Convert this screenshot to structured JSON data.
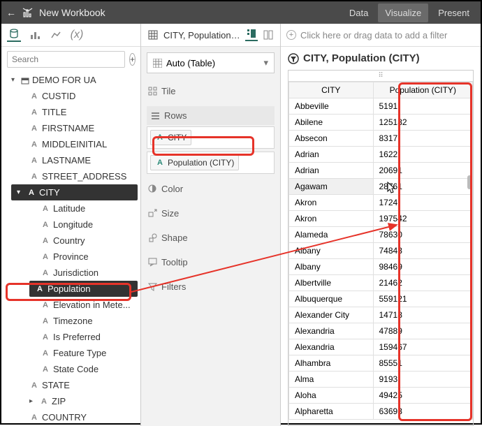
{
  "topbar": {
    "title": "New Workbook",
    "tabs": {
      "data": "Data",
      "visualize": "Visualize",
      "present": "Present"
    }
  },
  "sidebar": {
    "search_placeholder": "Search",
    "root": "DEMO FOR UA",
    "fields": {
      "custid": "CUSTID",
      "title": "TITLE",
      "firstname": "FIRSTNAME",
      "middleinitial": "MIDDLEINITIAL",
      "lastname": "LASTNAME",
      "street_address": "STREET_ADDRESS",
      "city": "CITY",
      "latitude": "Latitude",
      "longitude": "Longitude",
      "country": "Country",
      "province": "Province",
      "jurisdiction": "Jurisdiction",
      "population": "Population",
      "elevation": "Elevation in Mete...",
      "timezone": "Timezone",
      "is_preferred": "Is Preferred",
      "feature_type": "Feature Type",
      "state_code": "State Code",
      "state": "STATE",
      "zip": "ZIP",
      "country_top": "COUNTRY"
    }
  },
  "config": {
    "breadcrumb": "CITY, Population (CI...",
    "auto_label": "Auto (Table)",
    "tile": "Tile",
    "rows": "Rows",
    "pills": {
      "city": "CITY",
      "population": "Population (CITY)"
    },
    "color": "Color",
    "size": "Size",
    "shape": "Shape",
    "tooltip": "Tooltip",
    "filters": "Filters"
  },
  "viz": {
    "filter_hint": "Click here or drag data to add a filter",
    "title": "CITY, Population (CITY)",
    "columns": {
      "city": "CITY",
      "pop": "Population (CITY)"
    },
    "rows": [
      {
        "city": "Abbeville",
        "pop": "5191"
      },
      {
        "city": "Abilene",
        "pop": "125182"
      },
      {
        "city": "Absecon",
        "pop": "8317"
      },
      {
        "city": "Adrian",
        "pop": "1622"
      },
      {
        "city": "Adrian",
        "pop": "20691"
      },
      {
        "city": "Agawam",
        "pop": "28761"
      },
      {
        "city": "Akron",
        "pop": "1724"
      },
      {
        "city": "Akron",
        "pop": "197542"
      },
      {
        "city": "Alameda",
        "pop": "78630"
      },
      {
        "city": "Albany",
        "pop": "74843"
      },
      {
        "city": "Albany",
        "pop": "98469"
      },
      {
        "city": "Albertville",
        "pop": "21462"
      },
      {
        "city": "Albuquerque",
        "pop": "559121"
      },
      {
        "city": "Alexander City",
        "pop": "14718"
      },
      {
        "city": "Alexandria",
        "pop": "47889"
      },
      {
        "city": "Alexandria",
        "pop": "159467"
      },
      {
        "city": "Alhambra",
        "pop": "85551"
      },
      {
        "city": "Alma",
        "pop": "9193"
      },
      {
        "city": "Aloha",
        "pop": "49425"
      },
      {
        "city": "Alpharetta",
        "pop": "63693"
      }
    ]
  },
  "chart_data": {
    "type": "table",
    "title": "CITY, Population (CITY)",
    "columns": [
      "CITY",
      "Population (CITY)"
    ],
    "rows": [
      [
        "Abbeville",
        5191
      ],
      [
        "Abilene",
        125182
      ],
      [
        "Absecon",
        8317
      ],
      [
        "Adrian",
        1622
      ],
      [
        "Adrian",
        20691
      ],
      [
        "Agawam",
        28761
      ],
      [
        "Akron",
        1724
      ],
      [
        "Akron",
        197542
      ],
      [
        "Alameda",
        78630
      ],
      [
        "Albany",
        74843
      ],
      [
        "Albany",
        98469
      ],
      [
        "Albertville",
        21462
      ],
      [
        "Albuquerque",
        559121
      ],
      [
        "Alexander City",
        14718
      ],
      [
        "Alexandria",
        47889
      ],
      [
        "Alexandria",
        159467
      ],
      [
        "Alhambra",
        85551
      ],
      [
        "Alma",
        9193
      ],
      [
        "Aloha",
        49425
      ],
      [
        "Alpharetta",
        63693
      ]
    ]
  }
}
